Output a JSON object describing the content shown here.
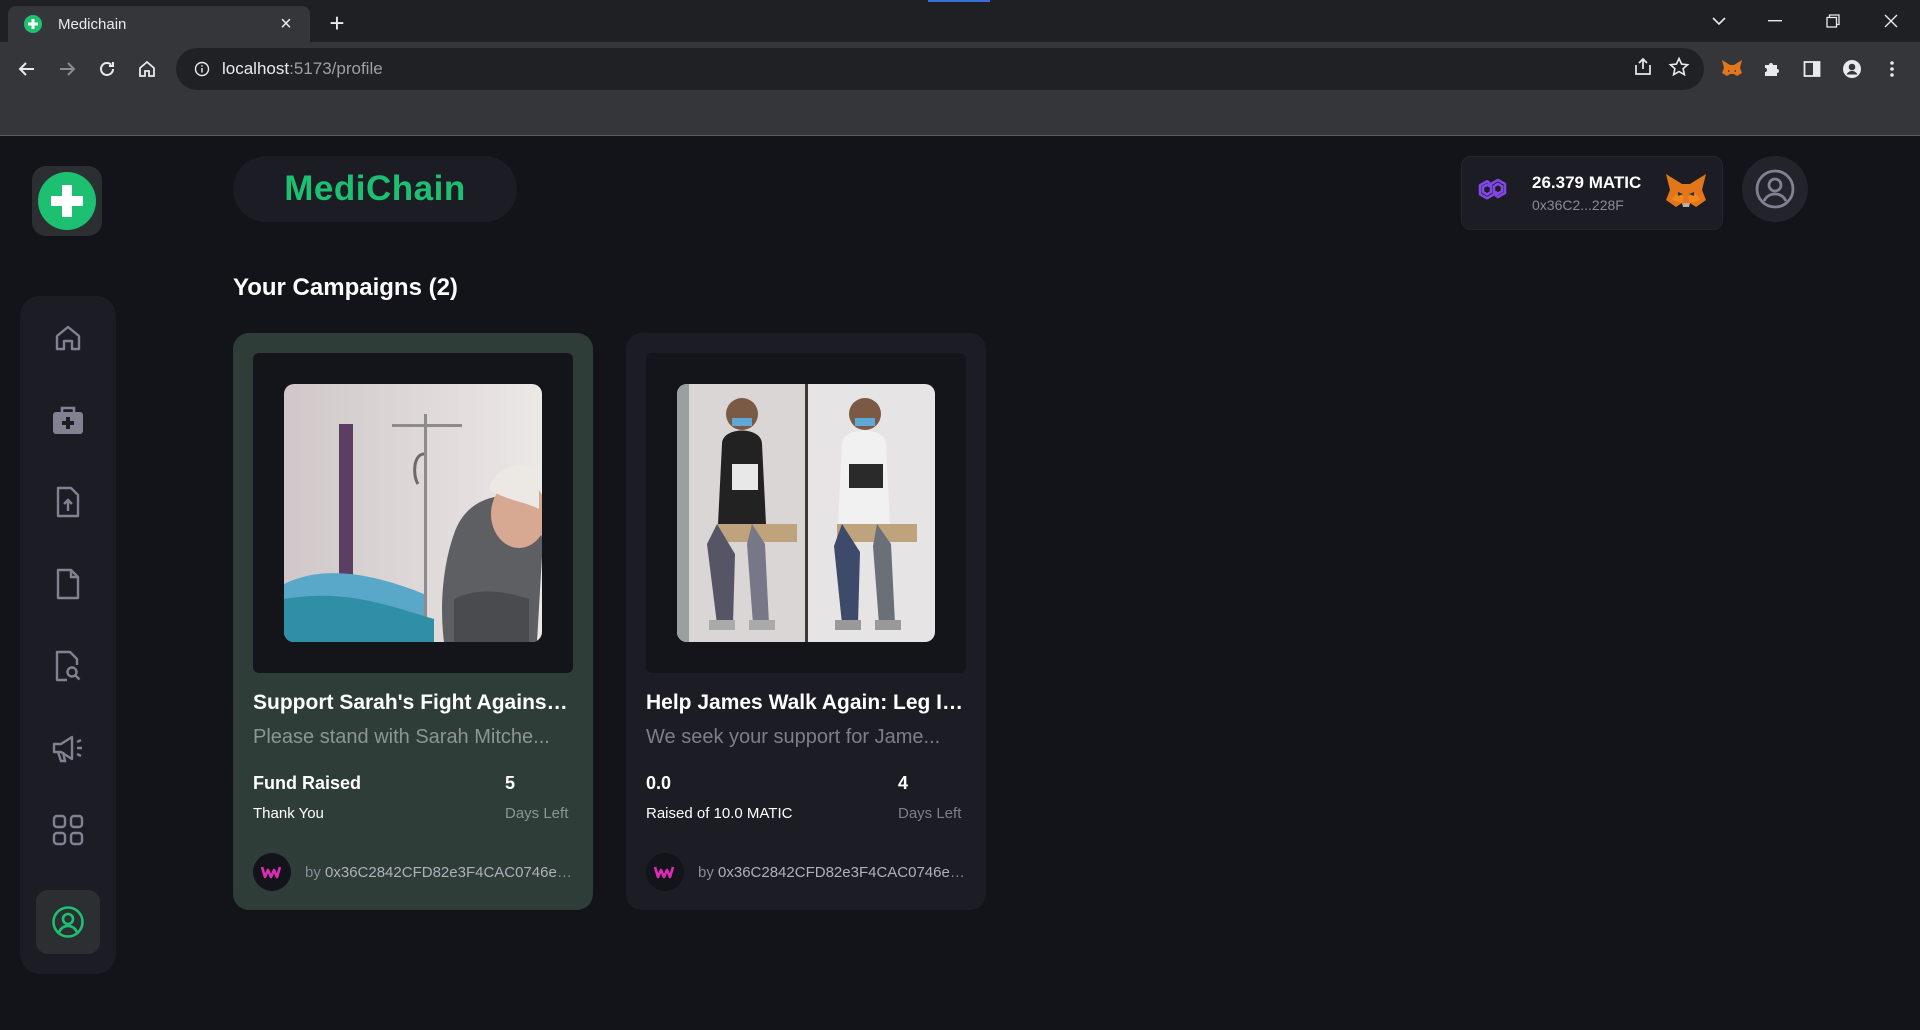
{
  "browser": {
    "tab_title": "Medichain",
    "tab_close": "×",
    "new_tab": "+",
    "url_host": "localhost",
    "url_path": ":5173/profile"
  },
  "app": {
    "brand": "MediChain",
    "wallet": {
      "balance": "26.379 MATIC",
      "address": "0x36C2...228F"
    },
    "section_title": "Your Campaigns (2)",
    "campaigns": [
      {
        "title": "Support Sarah's Fight Against ...",
        "description": "Please stand with Sarah Mitche...",
        "stat_main": "Fund Raised",
        "stat_sub": "Thank You",
        "days": "5",
        "days_label": "Days Left",
        "owner_prefix": "by ",
        "owner": "0x36C2842CFD82e3F4CAC0746e4..."
      },
      {
        "title": "Help James Walk Again: Leg Im...",
        "description": "We seek your support for Jame...",
        "stat_main": "0.0",
        "stat_sub": "Raised of 10.0 MATIC",
        "days": "4",
        "days_label": "Days Left",
        "owner_prefix": "by ",
        "owner": "0x36C2842CFD82e3F4CAC0746e4..."
      }
    ]
  },
  "colors": {
    "accent": "#1dc071",
    "card_active": "#2e3d37",
    "panel": "#1c1c24",
    "background": "#13131a"
  },
  "icons": {
    "sidebar": [
      "home-icon",
      "medkit-icon",
      "file-upload-icon",
      "file-icon",
      "file-search-icon",
      "megaphone-icon",
      "grid-icon",
      "user-circle-icon"
    ],
    "wallet": [
      "polygon-icon",
      "metamask-fox-icon"
    ]
  }
}
